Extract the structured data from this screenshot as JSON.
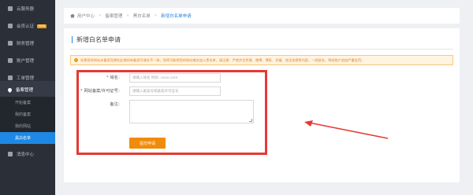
{
  "sidebar": {
    "items": [
      {
        "label": "云服务器",
        "icon": "server-icon"
      },
      {
        "label": "会员认证",
        "icon": "user-icon",
        "badge": "NEW"
      },
      {
        "label": "财务管理",
        "icon": "finance-icon"
      },
      {
        "label": "账户管理",
        "icon": "account-icon"
      },
      {
        "label": "工单管理",
        "icon": "ticket-icon"
      },
      {
        "label": "备案管理",
        "icon": "location-icon",
        "active": true
      }
    ],
    "subitems": [
      {
        "label": "开始备案"
      },
      {
        "label": "我的备案"
      },
      {
        "label": "我的网站"
      },
      {
        "label": "黑白名单",
        "active": true
      }
    ],
    "message_center": "消息中心"
  },
  "breadcrumb": {
    "home": "用户中心",
    "items": [
      "备案管理",
      "黑白名单"
    ],
    "current": "新增白名单申请"
  },
  "page": {
    "title": "新增白名单申请",
    "notice": "如果您的网站未备案而想在此期间有备案号域名不一致，您将可能将您的网站域名加入黑名单，请注意：严禁涉及色情、赌博、博彩、诈骗、违法违规等内容，一经核实，将给账户追加严重处罚。"
  },
  "form": {
    "domain_label": "域名：",
    "domain_placeholder": "请输入域名 例如: xxxx.com",
    "icp_label": "网站备案/许可证号：",
    "icp_placeholder": "请输入备案号或备案许可证号",
    "remark_label": "备注：",
    "submit_label": "提交申请"
  },
  "colors": {
    "highlight": "#e53935",
    "submit": "#f08c0a",
    "active_sub": "#1e88e5"
  }
}
